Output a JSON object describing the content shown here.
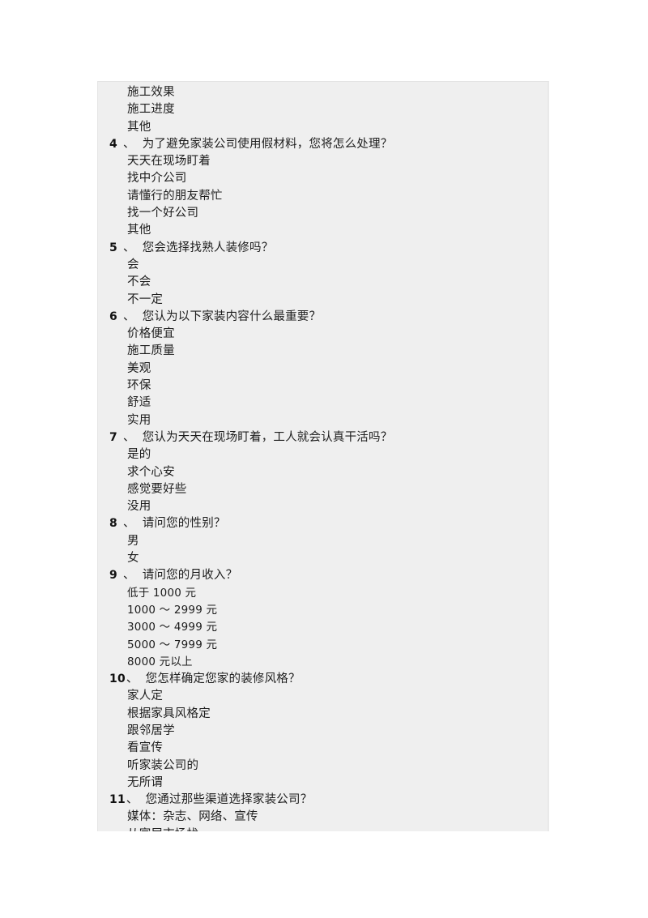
{
  "document": {
    "type": "questionnaire-page",
    "background_color": "#ffffff",
    "block_color": "#efefef",
    "text_color": "#1d1d1d"
  },
  "orphan_options": [
    {
      "label": "施工效果"
    },
    {
      "label": "施工进度"
    },
    {
      "label": "其他"
    }
  ],
  "questions": [
    {
      "number": "4",
      "mark": "、",
      "text": "为了避免家装公司使用假材料，您将怎么处理？",
      "options": [
        {
          "label": "天天在现场盯着"
        },
        {
          "label": "找中介公司"
        },
        {
          "label": "请懂行的朋友帮忙"
        },
        {
          "label": "找一个好公司"
        },
        {
          "label": "其他"
        }
      ]
    },
    {
      "number": "5",
      "mark": "、",
      "text": "您会选择找熟人装修吗？",
      "options": [
        {
          "label": "会"
        },
        {
          "label": "不会"
        },
        {
          "label": "不一定"
        }
      ]
    },
    {
      "number": "6",
      "mark": "、",
      "text": "您认为以下家装内容什么最重要？",
      "options": [
        {
          "label": "价格便宜"
        },
        {
          "label": "施工质量"
        },
        {
          "label": "美观"
        },
        {
          "label": "环保"
        },
        {
          "label": "舒适"
        },
        {
          "label": "实用"
        }
      ]
    },
    {
      "number": "7",
      "mark": "、",
      "text": "您认为天天在现场盯着，工人就会认真干活吗？",
      "options": [
        {
          "label": "是的"
        },
        {
          "label": "求个心安"
        },
        {
          "label": "感觉要好些"
        },
        {
          "label": "没用"
        }
      ]
    },
    {
      "number": "8",
      "mark": "、",
      "text": "请问您的性别？",
      "options": [
        {
          "label": "男"
        },
        {
          "label": "女"
        }
      ]
    },
    {
      "number": "9",
      "mark": "、",
      "text": "请问您的月收入？",
      "options": [
        {
          "label": "低于 1000 元",
          "numeric": true
        },
        {
          "label": "1000 ～ 2999 元",
          "numeric": true
        },
        {
          "label": "3000 ～ 4999 元",
          "numeric": true
        },
        {
          "label": "5000 ～ 7999 元",
          "numeric": true
        },
        {
          "label": "8000 元以上",
          "numeric": true
        }
      ]
    },
    {
      "number": "10",
      "mark": "、",
      "text": "您怎样确定您家的装修风格？",
      "options": [
        {
          "label": "家人定"
        },
        {
          "label": "根据家具风格定"
        },
        {
          "label": "跟邻居学"
        },
        {
          "label": "看宣传"
        },
        {
          "label": "听家装公司的"
        },
        {
          "label": "无所谓"
        }
      ]
    },
    {
      "number": "11",
      "mark": "、",
      "text": "您通过那些渠道选择家装公司？",
      "options": [
        {
          "label": "媒体：杂志、网络、宣传"
        },
        {
          "label": "从家居市场找"
        }
      ]
    }
  ]
}
